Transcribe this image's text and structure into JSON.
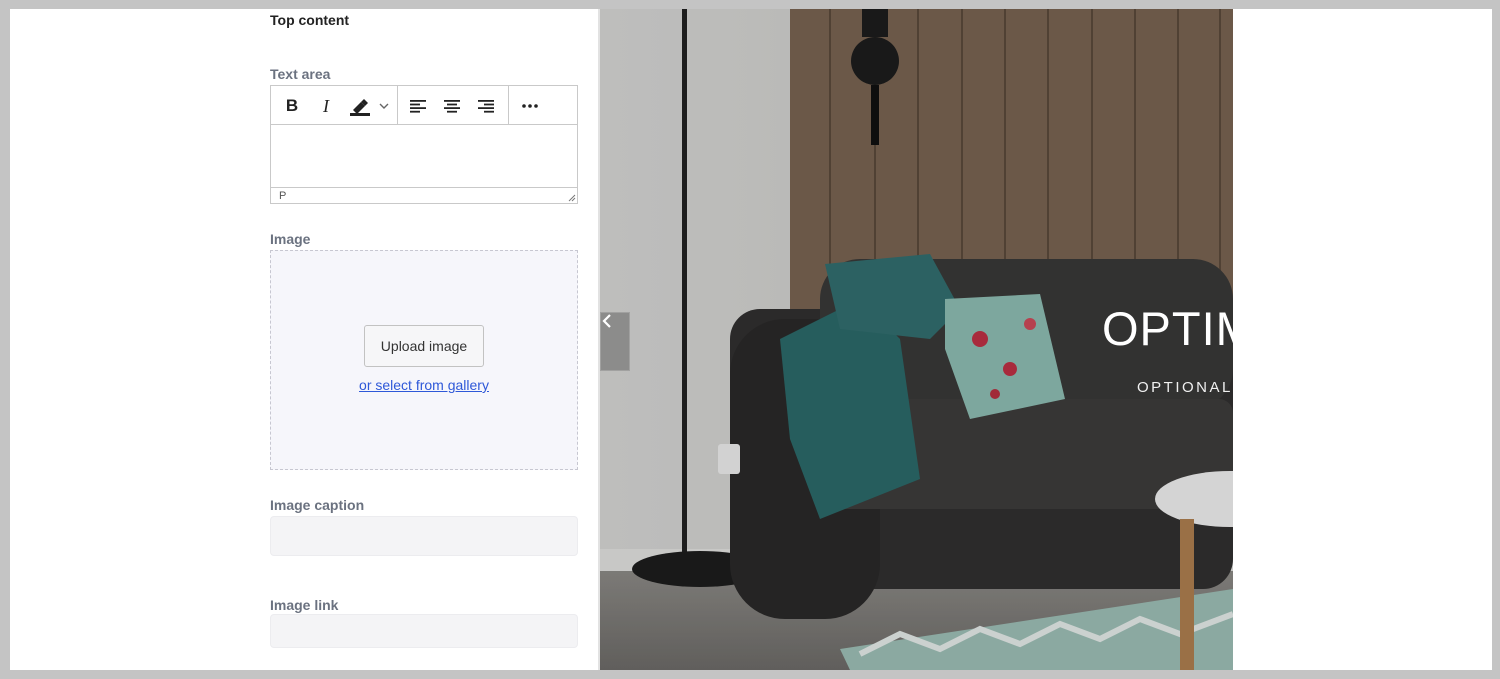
{
  "sidebar": {
    "section_title": "Top content",
    "text_area": {
      "label": "Text area",
      "toolbar": {
        "bold_label": "B",
        "italic_label": "I"
      },
      "status_path": "P"
    },
    "image": {
      "label": "Image",
      "upload_label": "Upload image",
      "gallery_link": "or select from gallery"
    },
    "caption": {
      "label": "Image caption",
      "value": ""
    },
    "link": {
      "label": "Image link",
      "value": ""
    }
  },
  "preview": {
    "hero_title": "OPTIM",
    "hero_subtitle": "OPTIONAL T"
  },
  "colors": {
    "link": "#2e58d8",
    "label": "#6b7280",
    "page_background": "#c4c4c4"
  }
}
